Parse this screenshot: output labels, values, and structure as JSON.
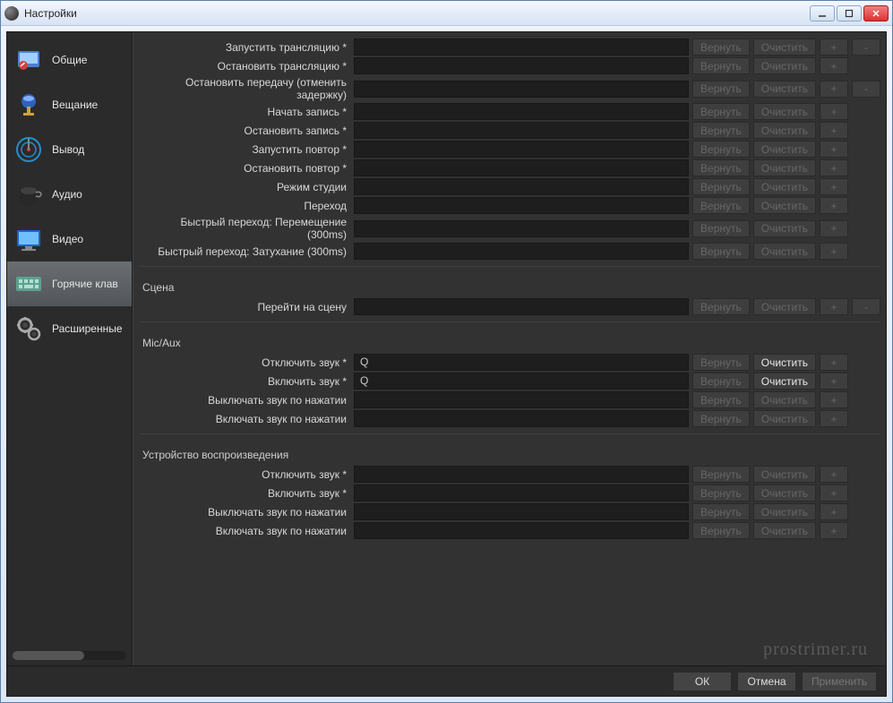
{
  "window": {
    "title": "Настройки"
  },
  "sidebar": {
    "items": [
      {
        "label": "Общие",
        "icon": "general"
      },
      {
        "label": "Вещание",
        "icon": "stream"
      },
      {
        "label": "Вывод",
        "icon": "output"
      },
      {
        "label": "Аудио",
        "icon": "audio"
      },
      {
        "label": "Видео",
        "icon": "video"
      },
      {
        "label": "Горячие клав",
        "icon": "hotkeys",
        "selected": true
      },
      {
        "label": "Расширенные",
        "icon": "advanced"
      }
    ]
  },
  "buttons": {
    "revert": "Вернуть",
    "clear": "Очистить",
    "plus": "+",
    "minus": "-"
  },
  "sections": [
    {
      "title": "",
      "rows": [
        {
          "label": "Запустить трансляцию *",
          "value": "",
          "revert_enabled": false,
          "clear_enabled": false,
          "has_minus": true
        },
        {
          "label": "Остановить трансляцию *",
          "value": "",
          "revert_enabled": false,
          "clear_enabled": false,
          "has_minus": false
        },
        {
          "label": "Остановить передачу (отменить задержку)",
          "value": "",
          "revert_enabled": false,
          "clear_enabled": false,
          "has_minus": true
        },
        {
          "label": "Начать запись *",
          "value": "",
          "revert_enabled": false,
          "clear_enabled": false,
          "has_minus": false
        },
        {
          "label": "Остановить запись *",
          "value": "",
          "revert_enabled": false,
          "clear_enabled": false,
          "has_minus": false
        },
        {
          "label": "Запустить повтор *",
          "value": "",
          "revert_enabled": false,
          "clear_enabled": false,
          "has_minus": false
        },
        {
          "label": "Остановить повтор *",
          "value": "",
          "revert_enabled": false,
          "clear_enabled": false,
          "has_minus": false
        },
        {
          "label": "Режим студии",
          "value": "",
          "revert_enabled": false,
          "clear_enabled": false,
          "has_minus": false
        },
        {
          "label": "Переход",
          "value": "",
          "revert_enabled": false,
          "clear_enabled": false,
          "has_minus": false
        },
        {
          "label": "Быстрый переход: Перемещение (300ms)",
          "value": "",
          "revert_enabled": false,
          "clear_enabled": false,
          "has_minus": false
        },
        {
          "label": "Быстрый переход: Затухание (300ms)",
          "value": "",
          "revert_enabled": false,
          "clear_enabled": false,
          "has_minus": false
        }
      ]
    },
    {
      "title": "Сцена",
      "rows": [
        {
          "label": "Перейти на сцену",
          "value": "",
          "revert_enabled": false,
          "clear_enabled": false,
          "has_minus": true
        }
      ]
    },
    {
      "title": "Mic/Aux",
      "rows": [
        {
          "label": "Отключить звук *",
          "value": "Q",
          "revert_enabled": false,
          "clear_enabled": true,
          "has_minus": false
        },
        {
          "label": "Включить звук *",
          "value": "Q",
          "revert_enabled": false,
          "clear_enabled": true,
          "has_minus": false
        },
        {
          "label": "Выключать звук по нажатии",
          "value": "",
          "revert_enabled": false,
          "clear_enabled": false,
          "has_minus": false
        },
        {
          "label": "Включать звук по нажатии",
          "value": "",
          "revert_enabled": false,
          "clear_enabled": false,
          "has_minus": false
        }
      ]
    },
    {
      "title": "Устройство воспроизведения",
      "rows": [
        {
          "label": "Отключить звук *",
          "value": "",
          "revert_enabled": false,
          "clear_enabled": false,
          "has_minus": false
        },
        {
          "label": "Включить звук *",
          "value": "",
          "revert_enabled": false,
          "clear_enabled": false,
          "has_minus": false
        },
        {
          "label": "Выключать звук по нажатии",
          "value": "",
          "revert_enabled": false,
          "clear_enabled": false,
          "has_minus": false
        },
        {
          "label": "Включать звук по нажатии",
          "value": "",
          "revert_enabled": false,
          "clear_enabled": false,
          "has_minus": false
        }
      ]
    }
  ],
  "footer": {
    "ok": "ОК",
    "cancel": "Отмена",
    "apply": "Применить"
  },
  "watermark": "prostrimer.ru"
}
